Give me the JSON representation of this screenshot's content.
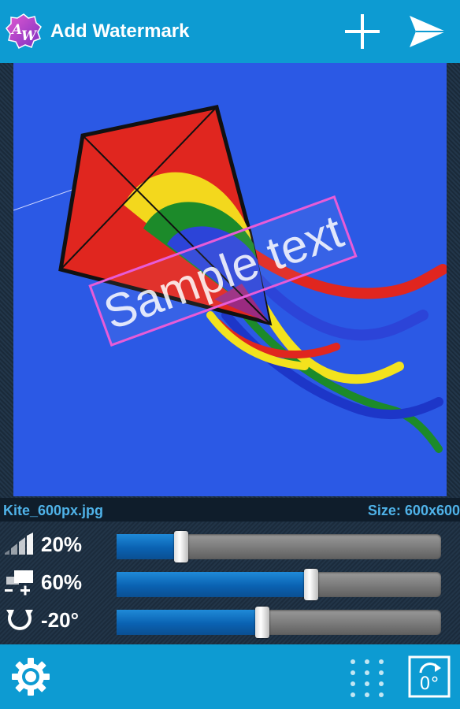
{
  "app": {
    "title": "Add Watermark",
    "logo_text": "AW"
  },
  "toolbar": {
    "add_icon": "plus-icon",
    "send_icon": "send-icon"
  },
  "preview": {
    "watermark_text": "Sample text",
    "watermark_rotation_deg": -20,
    "subject": "kite-photo"
  },
  "info": {
    "filename": "Kite_600px.jpg",
    "size": "Size: 600x600"
  },
  "controls": [
    {
      "name": "opacity",
      "icon": "opacity-icon",
      "value": "20%",
      "level": 0.2
    },
    {
      "name": "scale",
      "icon": "scale-icon",
      "value": "60%",
      "level": 0.6
    },
    {
      "name": "rotation",
      "icon": "rotate-icon",
      "value": "-20°",
      "level": 0.45
    }
  ],
  "bottom": {
    "settings_icon": "gear-icon",
    "grid_icon": "grid-icon",
    "rotate_label": "0°"
  },
  "colors": {
    "accent": "#0d9bd2",
    "slider_fill": "#0a62b2",
    "photo_bg": "#2b59e5"
  }
}
